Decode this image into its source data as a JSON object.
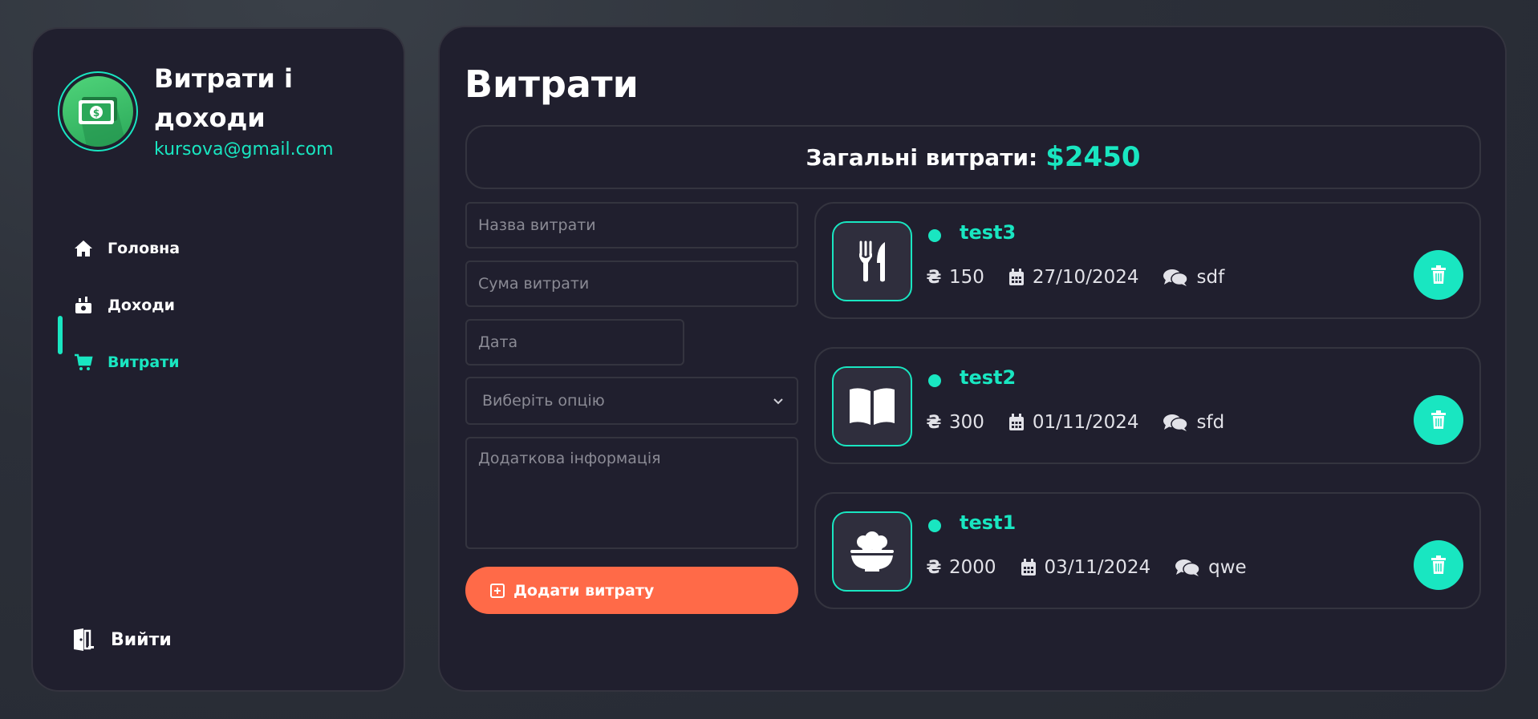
{
  "sidebar": {
    "title": "Витрати і доходи",
    "email": "kursova@gmail.com",
    "nav": [
      {
        "label": "Головна",
        "icon": "home-icon"
      },
      {
        "label": "Доходи",
        "icon": "money-bill-icon"
      },
      {
        "label": "Витрати",
        "icon": "cart-icon",
        "active": true
      }
    ],
    "logout_label": "Вийти"
  },
  "main": {
    "title": "Витрати",
    "total_label": "Загальні витрати:",
    "total_value": "$2450"
  },
  "form": {
    "name_placeholder": "Назва витрати",
    "amount_placeholder": "Сума витрати",
    "date_placeholder": "Дата",
    "select_value": "Виберіть опцію",
    "info_placeholder": "Додаткова інформація",
    "submit_label": "Додати витрату"
  },
  "expenses": [
    {
      "title": "test3",
      "amount": "150",
      "date": "27/10/2024",
      "note": "sdf",
      "category_icon": "utensils-icon"
    },
    {
      "title": "test2",
      "amount": "300",
      "date": "01/11/2024",
      "note": "sfd",
      "category_icon": "book-icon"
    },
    {
      "title": "test1",
      "amount": "2000",
      "date": "03/11/2024",
      "note": "qwe",
      "category_icon": "bowl-food-icon"
    }
  ],
  "colors": {
    "accent": "#19e6c1",
    "button": "#ff6a48",
    "panel": "#201f2e"
  }
}
